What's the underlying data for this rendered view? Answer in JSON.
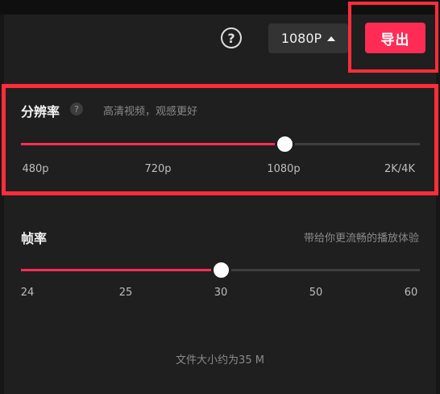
{
  "header": {
    "help_icon_glyph": "?",
    "resolution_dropdown": {
      "value": "1080P",
      "icon": "caret-up-icon"
    },
    "export_button_label": "导出"
  },
  "resolution": {
    "title": "分辨率",
    "help_glyph": "?",
    "subtitle": "高清视频，观感更好",
    "ticks": [
      "480p",
      "720p",
      "1080p",
      "2K/4K"
    ],
    "selected": "1080p",
    "slider_fraction": 0.66
  },
  "framerate": {
    "title": "帧率",
    "subtitle": "带给你更流畅的播放体验",
    "ticks": [
      "24",
      "25",
      "30",
      "50",
      "60"
    ],
    "selected": "30",
    "slider_fraction": 0.5
  },
  "file_size_text": "文件大小约为35 M",
  "colors": {
    "accent": "#fe2c55",
    "highlight": "#ff2d3a",
    "background": "#1f1f1f"
  }
}
